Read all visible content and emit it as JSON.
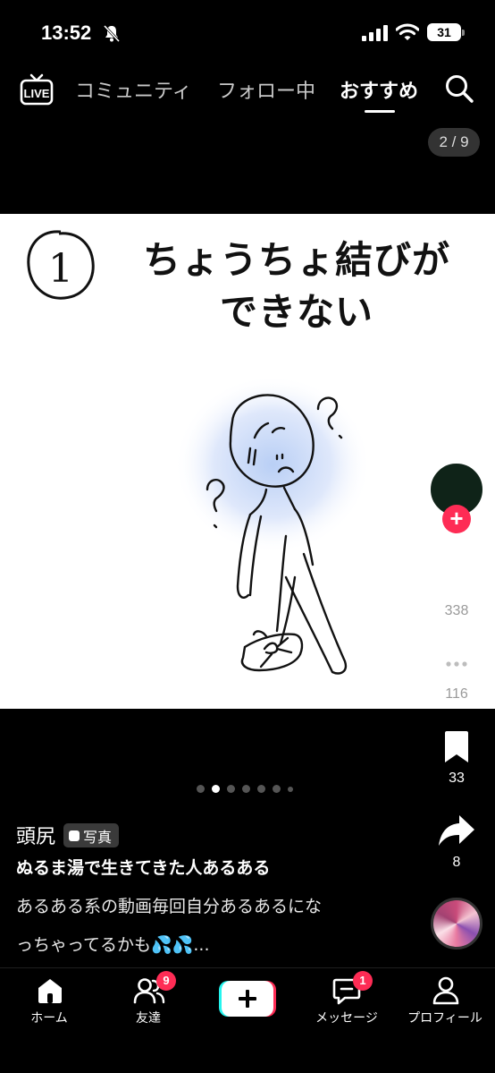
{
  "status_bar": {
    "time": "13:52",
    "battery": "31"
  },
  "nav": {
    "tabs": [
      {
        "label": "コミュニティ"
      },
      {
        "label": "フォロー中"
      },
      {
        "label": "おすすめ"
      }
    ],
    "live_label": "LIVE"
  },
  "post": {
    "page_counter": "2 / 9",
    "image_text": {
      "number": "1",
      "line1": "ちょうちょ結びが",
      "line2": "できない"
    },
    "likes": "338",
    "comments": "116",
    "bookmarks": "33",
    "shares": "8",
    "slides_total": 7,
    "slides_active_index": 1,
    "username": "頭尻",
    "type_badge": "写真",
    "title": "ぬるま湯で生きてきた人あるある",
    "description_line1": "あるある系の動画毎回自分あるあるにな",
    "description_line2": "っちゃってるかも💦💦..."
  },
  "bottom_nav": {
    "items": [
      {
        "label": "ホーム"
      },
      {
        "label": "友達",
        "badge": "9"
      },
      {
        "label": ""
      },
      {
        "label": "メッセージ",
        "badge": "1"
      },
      {
        "label": "プロフィール"
      }
    ]
  },
  "colors": {
    "accent": "#fe2c55",
    "background": "#000000"
  },
  "icons": [
    "mute-icon",
    "signal-icon",
    "wifi-icon",
    "battery-icon",
    "live-icon",
    "search-icon",
    "heart-icon",
    "comment-icon",
    "bookmark-icon",
    "share-icon",
    "home-icon",
    "friends-icon",
    "plus-icon",
    "message-icon",
    "profile-icon"
  ]
}
